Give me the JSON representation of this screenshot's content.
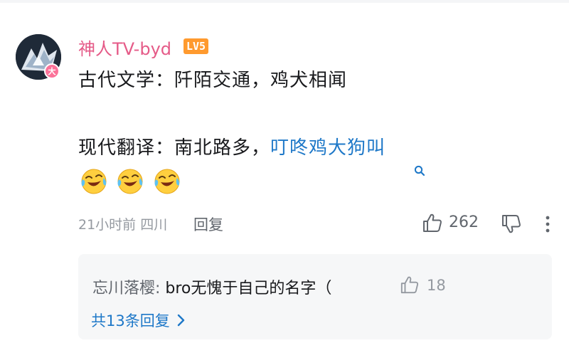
{
  "comment": {
    "author": "神人TV-byd",
    "level": "LV5",
    "avatar_badge": "大",
    "line1": "古代文学：阡陌交通，鸡犬相闻",
    "line2_prefix": "现代翻译：南北路多，",
    "line2_link": "叮咚鸡大狗叫",
    "emojis": [
      "laughing-crying-emoji",
      "laughing-crying-emoji",
      "laughing-crying-emoji"
    ],
    "time_location": "21小时前 四川",
    "reply_label": "回复",
    "like_count": "262"
  },
  "replies": {
    "preview_author": "忘川落樱: ",
    "preview_text": "bro无愧于自己的名字（",
    "preview_like_count": "18",
    "view_all_label": "共13条回复"
  },
  "colors": {
    "username": "#e55b88",
    "level_badge": "#ff9a2e",
    "link": "#1e78c8",
    "muted": "#9499a0"
  }
}
